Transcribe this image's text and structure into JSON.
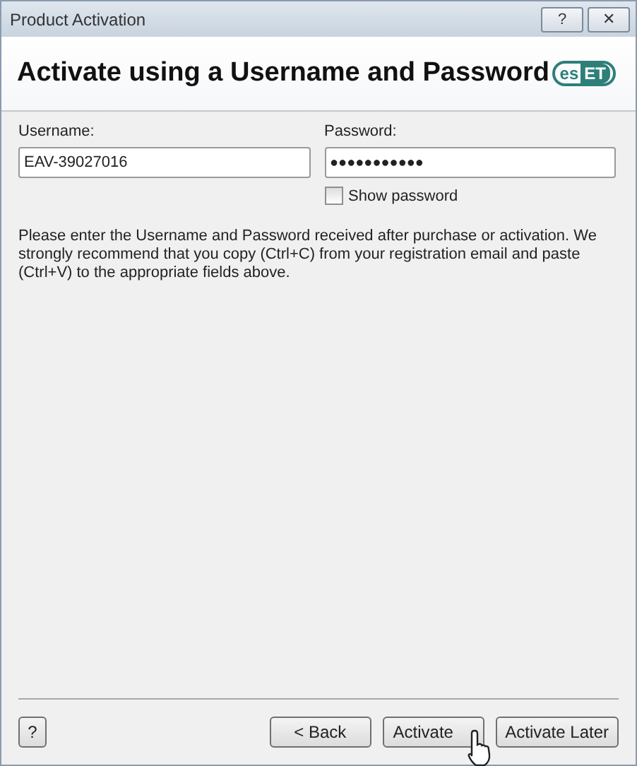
{
  "window": {
    "title": "Product Activation",
    "help_button": "?",
    "close_button": "✕"
  },
  "header": {
    "title": "Activate using a Username and Password",
    "logo": [
      "es",
      "ET"
    ]
  },
  "username": {
    "label": "Username:",
    "value": "EAV-39027016"
  },
  "password": {
    "label": "Password:",
    "value": "●●●●●●●●●●●"
  },
  "show_password": {
    "label": "Show password",
    "checked": false
  },
  "instructions": "Please enter the Username and Password received after purchase or activation. We strongly recommend that you copy (Ctrl+C) from your registration email and paste (Ctrl+V) to the appropriate fields above.",
  "footer": {
    "help": "?",
    "buttons": [
      "< Back",
      "Activate",
      "Activate Later"
    ]
  }
}
